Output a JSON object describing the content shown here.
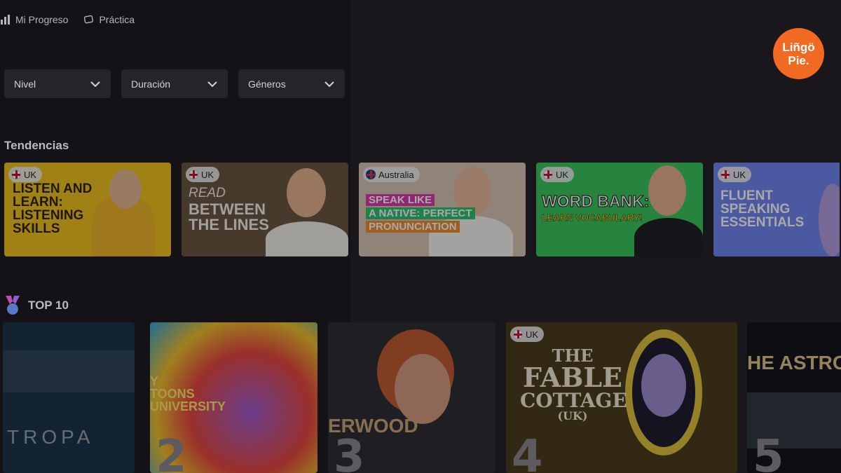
{
  "nav": {
    "progress_label": "Mi Progreso",
    "practice_label": "Práctica"
  },
  "logo": {
    "line1": "Liñgö",
    "line2": "Pie."
  },
  "filters": [
    {
      "label": "Nivel"
    },
    {
      "label": "Duración"
    },
    {
      "label": "Géneros"
    }
  ],
  "trending": {
    "title": "Tendencias",
    "cards": [
      {
        "badge": "UK",
        "text": "Listen and learn: listening skills",
        "bg": "#f2c21b"
      },
      {
        "badge": "UK",
        "text_top": "Read",
        "text_bottom": "Between the lines",
        "bg": "#6b5440"
      },
      {
        "badge": "Australia",
        "line1": "Speak like",
        "line2": "a native: perfect",
        "line3": "pronunciation",
        "bg": "#d9c7b6"
      },
      {
        "badge": "UK",
        "line1": "Word bank:",
        "line2": "Learn vocabulary!",
        "bg": "#37c75a"
      },
      {
        "badge": "UK",
        "text": "Fluent speaking essentials",
        "bg": "#6f86f0"
      }
    ]
  },
  "top10": {
    "title": "TOP 10",
    "cards": [
      {
        "rank": "",
        "caption": "TROPA"
      },
      {
        "rank": "2",
        "caption": "Y TOONS UNIVERSITY"
      },
      {
        "rank": "3",
        "caption": "ERWOOD"
      },
      {
        "rank": "4",
        "badge": "UK",
        "line1": "THE",
        "line2": "FABLE",
        "line3": "COTTAGE",
        "line4": "(UK)"
      },
      {
        "rank": "5",
        "caption": "HE ASTRO"
      }
    ]
  }
}
